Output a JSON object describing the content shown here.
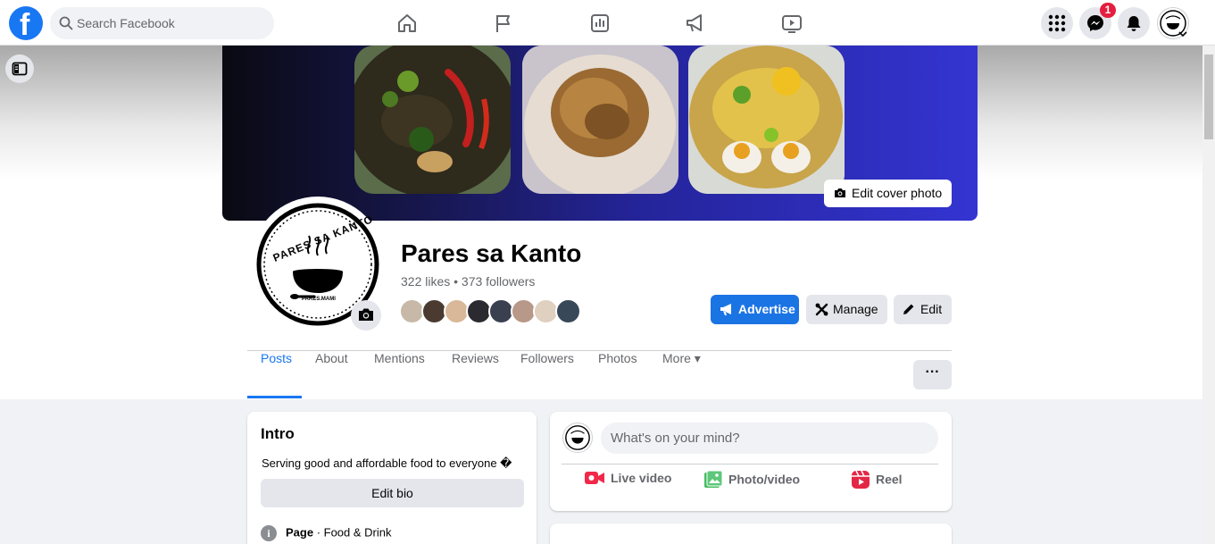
{
  "topbar": {
    "logo_letter": "f",
    "search_placeholder": "Search Facebook",
    "nav_icons": [
      "home-icon",
      "flag-icon",
      "insights-icon",
      "megaphone-icon",
      "video-icon"
    ],
    "messenger_badge": "1",
    "right_icons": [
      "menu-grid-icon",
      "messenger-icon",
      "bell-icon",
      "account-avatar"
    ]
  },
  "profile": {
    "name": "Pares sa Kanto",
    "stats": "322 likes • 373 followers",
    "logo_text_top": "PARES SA KANTO",
    "logo_text_bottom": "PARES.MAMI",
    "edit_cover_label": "Edit cover photo"
  },
  "actions": {
    "advertise": "Advertise",
    "manage": "Manage",
    "edit": "Edit"
  },
  "tabs": [
    {
      "label": "Posts",
      "active": true
    },
    {
      "label": "About"
    },
    {
      "label": "Mentions"
    },
    {
      "label": "Reviews"
    },
    {
      "label": "Followers"
    },
    {
      "label": "Photos"
    },
    {
      "label": "More ▾"
    }
  ],
  "more_options": "···",
  "intro": {
    "title": "Intro",
    "bio": "Serving good and affordable food to everyone �",
    "edit_bio": "Edit bio",
    "page_label": "Page",
    "category": " · Food & Drink"
  },
  "composer": {
    "placeholder": "What's on your mind?",
    "live_video": "Live video",
    "photo_video": "Photo/video",
    "reel": "Reel"
  },
  "colors": {
    "accent": "#1877f2",
    "badge": "#e41e3f",
    "live": "#f02849",
    "photo": "#45bd62",
    "reel": "#e42645"
  }
}
